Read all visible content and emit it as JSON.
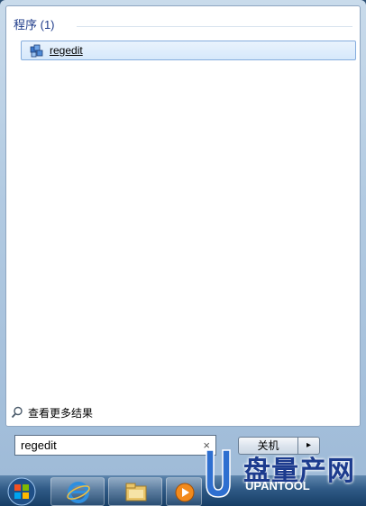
{
  "start_menu": {
    "section_title": "程序 (1)",
    "results": [
      {
        "label": "regedit",
        "icon": "regedit-icon"
      }
    ],
    "see_more_label": "查看更多结果",
    "search": {
      "value": "regedit",
      "clear_glyph": "×"
    },
    "shutdown_label": "关机",
    "shutdown_arrow": "▸"
  },
  "taskbar": {
    "items": [
      {
        "icon": "windows-orb-icon"
      },
      {
        "icon": "internet-explorer-icon"
      },
      {
        "icon": "file-explorer-icon"
      },
      {
        "icon": "media-player-icon"
      }
    ]
  },
  "watermark": {
    "title": "盘量产网",
    "brand": "UPANTOOL",
    "colors": {
      "primary": "#1c3b8e",
      "accent": "#2e6fd0"
    }
  }
}
